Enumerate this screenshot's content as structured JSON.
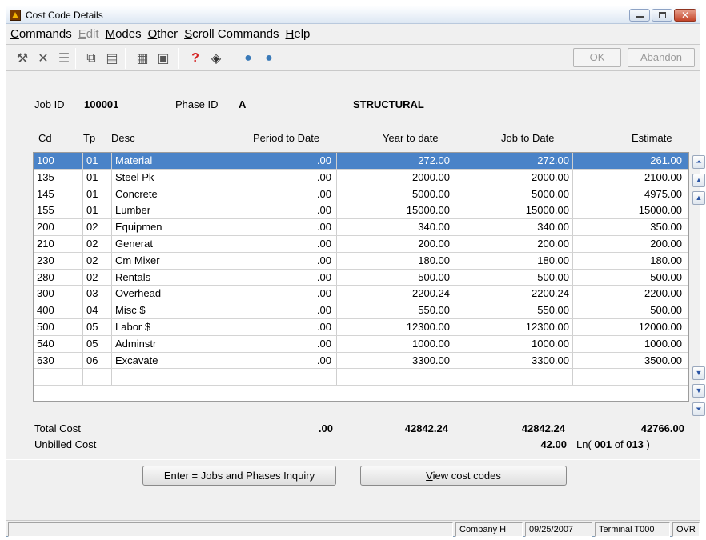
{
  "window": {
    "title": "Cost Code Details"
  },
  "menu": {
    "commands": {
      "u": "C",
      "rest": "ommands"
    },
    "edit": {
      "u": "E",
      "rest": "dit"
    },
    "modes": {
      "u": "M",
      "rest": "odes"
    },
    "other": {
      "u": "O",
      "rest": "ther"
    },
    "scroll": {
      "u": "S",
      "rest": "croll Commands"
    },
    "help": {
      "u": "H",
      "rest": "elp"
    }
  },
  "toolbar": {
    "ok_label": "OK",
    "abandon_label": "Abandon",
    "help_glyph": "?"
  },
  "header": {
    "job_label": "Job ID",
    "job_value": "100001",
    "phase_label": "Phase ID",
    "phase_value": "A",
    "phase_desc": "STRUCTURAL"
  },
  "columns": {
    "cd": "Cd",
    "tp": "Tp",
    "desc": "Desc",
    "ptd": "Period to Date",
    "ytd": "Year to date",
    "jtd": "Job to Date",
    "est": "Estimate"
  },
  "rows": [
    {
      "cd": "100",
      "tp": "01",
      "desc": "Material",
      "ptd": ".00",
      "ytd": "272.00",
      "jtd": "272.00",
      "est": "261.00"
    },
    {
      "cd": "135",
      "tp": "01",
      "desc": "Steel Pk",
      "ptd": ".00",
      "ytd": "2000.00",
      "jtd": "2000.00",
      "est": "2100.00"
    },
    {
      "cd": "145",
      "tp": "01",
      "desc": "Concrete",
      "ptd": ".00",
      "ytd": "5000.00",
      "jtd": "5000.00",
      "est": "4975.00"
    },
    {
      "cd": "155",
      "tp": "01",
      "desc": "Lumber",
      "ptd": ".00",
      "ytd": "15000.00",
      "jtd": "15000.00",
      "est": "15000.00"
    },
    {
      "cd": "200",
      "tp": "02",
      "desc": "Equipmen",
      "ptd": ".00",
      "ytd": "340.00",
      "jtd": "340.00",
      "est": "350.00"
    },
    {
      "cd": "210",
      "tp": "02",
      "desc": "Generat",
      "ptd": ".00",
      "ytd": "200.00",
      "jtd": "200.00",
      "est": "200.00"
    },
    {
      "cd": "230",
      "tp": "02",
      "desc": "Cm Mixer",
      "ptd": ".00",
      "ytd": "180.00",
      "jtd": "180.00",
      "est": "180.00"
    },
    {
      "cd": "280",
      "tp": "02",
      "desc": "Rentals",
      "ptd": ".00",
      "ytd": "500.00",
      "jtd": "500.00",
      "est": "500.00"
    },
    {
      "cd": "300",
      "tp": "03",
      "desc": "Overhead",
      "ptd": ".00",
      "ytd": "2200.24",
      "jtd": "2200.24",
      "est": "2200.00"
    },
    {
      "cd": "400",
      "tp": "04",
      "desc": "Misc $",
      "ptd": ".00",
      "ytd": "550.00",
      "jtd": "550.00",
      "est": "500.00"
    },
    {
      "cd": "500",
      "tp": "05",
      "desc": "Labor $",
      "ptd": ".00",
      "ytd": "12300.00",
      "jtd": "12300.00",
      "est": "12000.00"
    },
    {
      "cd": "540",
      "tp": "05",
      "desc": "Adminstr",
      "ptd": ".00",
      "ytd": "1000.00",
      "jtd": "1000.00",
      "est": "1000.00"
    },
    {
      "cd": "630",
      "tp": "06",
      "desc": "Excavate",
      "ptd": ".00",
      "ytd": "3300.00",
      "jtd": "3300.00",
      "est": "3500.00"
    },
    {
      "cd": "",
      "tp": "",
      "desc": "",
      "ptd": "",
      "ytd": "",
      "jtd": "",
      "est": ""
    }
  ],
  "totals": {
    "total_label": "Total Cost",
    "ptd": ".00",
    "ytd": "42842.24",
    "jtd": "42842.24",
    "est": "42766.00",
    "unbilled_label": "Unbilled Cost",
    "unbilled_value": "42.00",
    "ln_prefix": "Ln(",
    "ln_current": "001",
    "ln_of": "of",
    "ln_total": "013",
    "ln_suffix": ")"
  },
  "buttons": {
    "inquiry_label": "Enter = Jobs and Phases Inquiry",
    "view_u": "V",
    "view_rest": "iew cost codes"
  },
  "status": {
    "company": "Company H",
    "date": "09/25/2007",
    "terminal": "Terminal T000",
    "mode": "OVR"
  },
  "colors": {
    "selection": "#4a83c8"
  }
}
